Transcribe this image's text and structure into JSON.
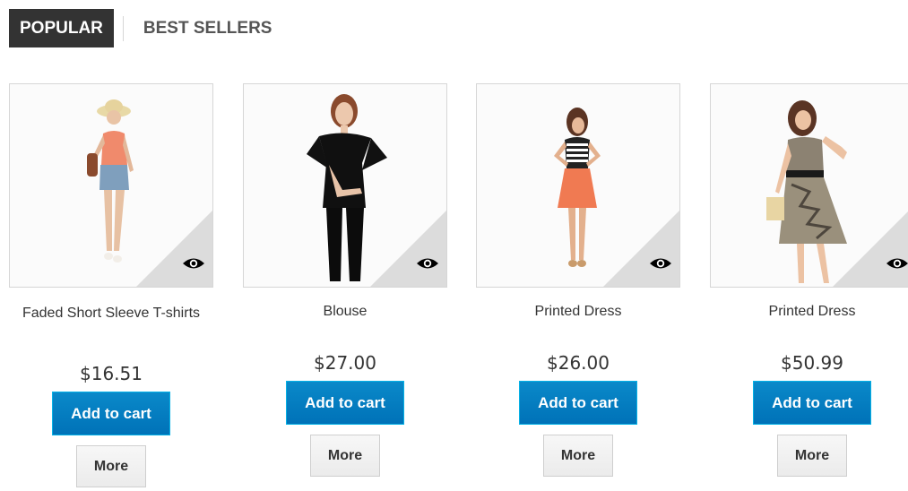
{
  "tabs": {
    "popular": "POPULAR",
    "best_sellers": "BEST SELLERS"
  },
  "products": [
    {
      "name": "Faded Short Sleeve T-shirts",
      "price": "$16.51",
      "add_to_cart": "Add to cart",
      "more": "More"
    },
    {
      "name": "Blouse",
      "price": "$27.00",
      "add_to_cart": "Add to cart",
      "more": "More"
    },
    {
      "name": "Printed Dress",
      "price": "$26.00",
      "add_to_cart": "Add to cart",
      "more": "More"
    },
    {
      "name": "Printed Dress",
      "price": "$50.99",
      "add_to_cart": "Add to cart",
      "more": "More"
    }
  ],
  "icons": {
    "quick_view": "eye-icon"
  },
  "colors": {
    "active_tab": "#333333",
    "cart_button": "#0a89c9",
    "more_button": "#f0f0f0"
  }
}
